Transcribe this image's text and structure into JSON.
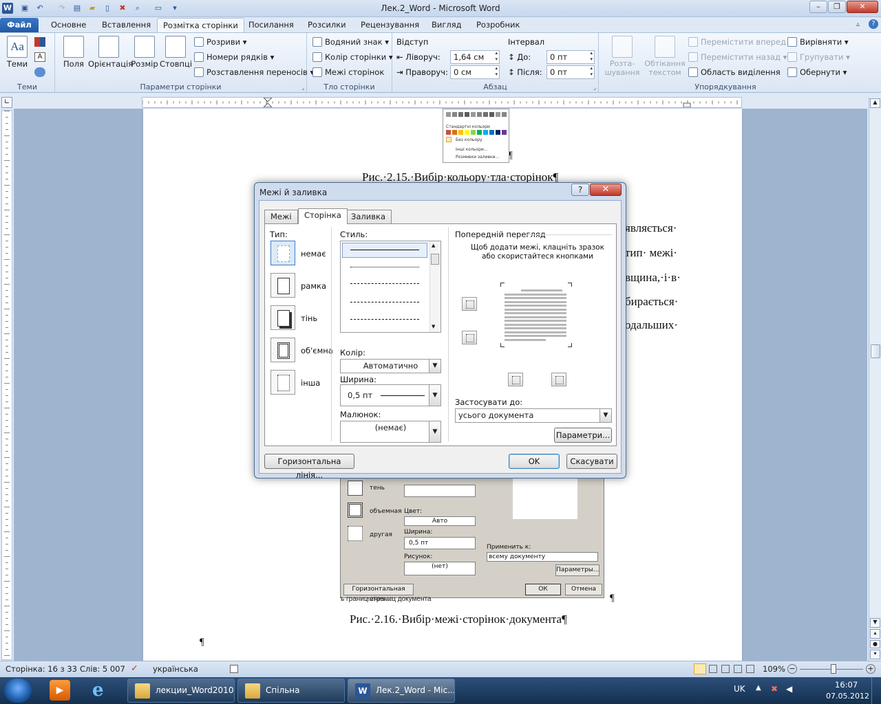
{
  "window": {
    "title": "Лек.2_Word - Microsoft Word"
  },
  "tabs": [
    "Файл",
    "Основне",
    "Вставлення",
    "Розмітка сторінки",
    "Посилання",
    "Розсилки",
    "Рецензування",
    "Вигляд",
    "Розробник"
  ],
  "ribbon": {
    "themes": {
      "btn": "Теми",
      "label": "Теми"
    },
    "page_setup": {
      "margins": "Поля",
      "orientation": "Орієнтація",
      "size": "Розмір",
      "columns": "Стовпці",
      "breaks": "Розриви",
      "line_numbers": "Номери рядків",
      "hyphenation": "Розставлення переносів",
      "label": "Параметри сторінки"
    },
    "page_bg": {
      "watermark": "Водяний знак",
      "page_color": "Колір сторінки",
      "page_borders": "Межі сторінок",
      "label": "Тло сторінки"
    },
    "paragraph": {
      "indent": "Відступ",
      "left": "Ліворуч:",
      "left_val": "1,64 см",
      "right": "Праворуч:",
      "right_val": "0 см",
      "spacing": "Інтервал",
      "before": "До:",
      "before_val": "0 пт",
      "after": "Після:",
      "after_val": "0 пт",
      "label": "Абзац"
    },
    "arrange": {
      "position": "Розта-\nшування",
      "wrap": "Обтікання\nтекстом",
      "forward": "Перемістити вперед",
      "backward": "Перемістити назад",
      "selection": "Область виділення",
      "align": "Вирівняти",
      "group": "Групувати",
      "rotate": "Обернути",
      "label": "Упорядкування"
    }
  },
  "doc": {
    "caption1": "Рис.·2.15.·Вибір·кольору·тла·сторінок¶",
    "r1": "являється·",
    "r2": "тип·  межі·",
    "r3": "вщина,·і·в·",
    "r4": "бирається·",
    "r5": "одальших·",
    "caption2": "Рис.·2.16.·Вибір·межі·сторінок·документа¶",
    "pilcrow": "¶",
    "old_caption": "ъ границ страниц документа"
  },
  "colorpop": {
    "std": "Стандартні кольори",
    "none": "Без кольору",
    "more": "Інші кольори...",
    "fill": "Розмивки заливки..."
  },
  "olddlg": {
    "shadow": "тень",
    "three": "объемная",
    "custom": "другая",
    "color": "Цвет:",
    "color_val": "Авто",
    "width": "Ширина:",
    "width_val": "0,5 пт",
    "art": "Рисунок:",
    "art_val": "(нет)",
    "apply": "Применить к:",
    "apply_val": "всему документу",
    "options": "Параметры...",
    "hline": "Горизонтальная линия...",
    "ok": "ОК",
    "cancel": "Отмена"
  },
  "dialog": {
    "title": "Межі й заливка",
    "help": "?",
    "close": "✕",
    "tabs": [
      "Межі",
      "Сторінка",
      "Заливка"
    ],
    "type_label": "Тип:",
    "types": [
      "немає",
      "рамка",
      "тінь",
      "об'ємна",
      "інша"
    ],
    "style_label": "Стиль:",
    "color_label": "Колір:",
    "color_val": "Автоматично",
    "width_label": "Ширина:",
    "width_val": "0,5 пт",
    "art_label": "Малюнок:",
    "art_val": "(немає)",
    "preview_label": "Попередній перегляд",
    "preview_hint": "Щоб додати межі, клацніть зразок або скористайтеся кнопками",
    "apply_label": "Застосувати до:",
    "apply_val": "усього документа",
    "options_btn": "Параметри...",
    "hline_btn": "Горизонтальна лінія...",
    "ok_btn": "OK",
    "cancel_btn": "Скасувати"
  },
  "status": {
    "page": "Сторінка: 16 з 33",
    "words": "Слів: 5 007",
    "lang": "українська",
    "zoom": "109%"
  },
  "taskbar": {
    "items": [
      "лекции_Word2010",
      "Спільна",
      "Лек.2_Word - Mic..."
    ],
    "lang": "UK",
    "time": "16:07",
    "date": "07.05.2012"
  }
}
